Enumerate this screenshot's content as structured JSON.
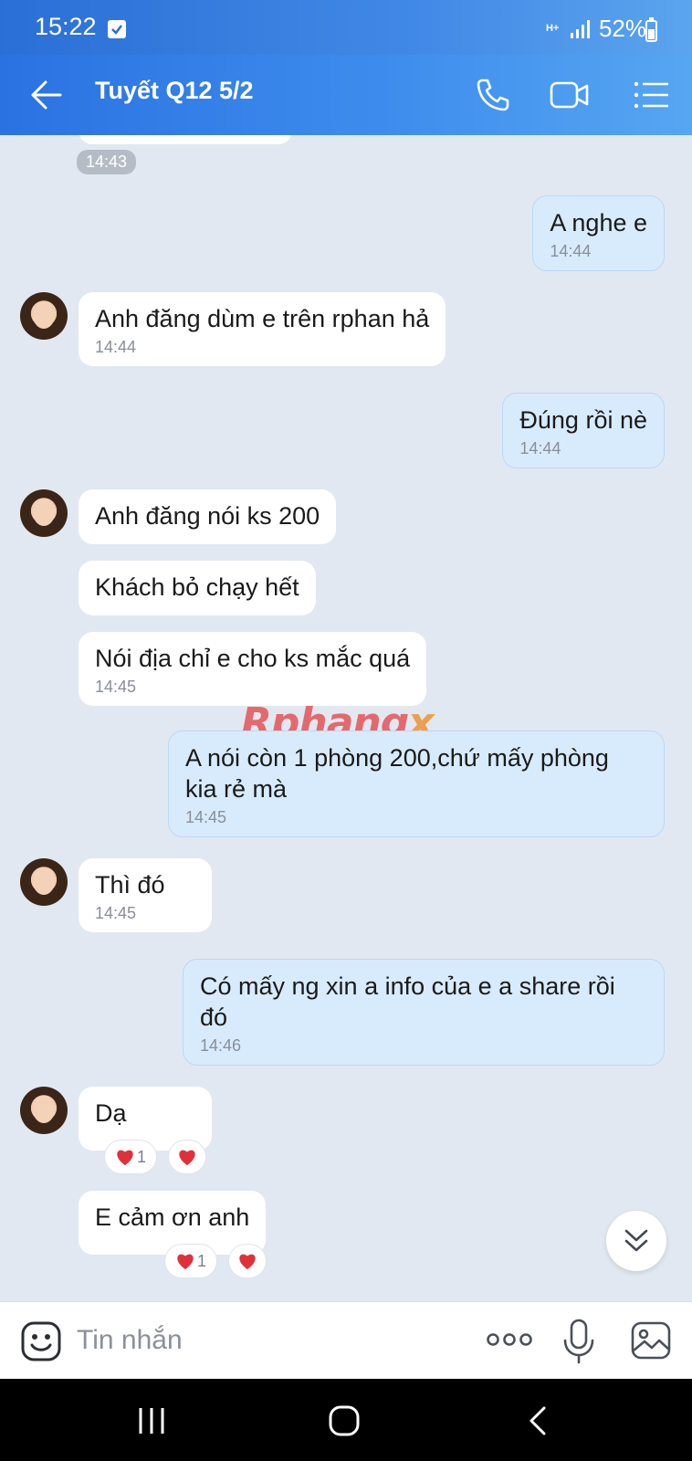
{
  "status_bar": {
    "time": "15:22",
    "network": "H+",
    "battery": "52%"
  },
  "header": {
    "title": "Tuyết Q12 5/2"
  },
  "chat": {
    "top_timestamp": "14:43",
    "messages": [
      {
        "side": "out",
        "text": "A nghe e",
        "time": "14:44"
      },
      {
        "side": "in",
        "text": "Anh đăng dùm e trên rphan hả",
        "time": "14:44"
      },
      {
        "side": "out",
        "text": "Đúng rồi nè",
        "time": "14:44"
      },
      {
        "side": "in",
        "text": "Anh đăng nói ks 200",
        "time": ""
      },
      {
        "side": "in",
        "text": "Khách bỏ chạy hết",
        "time": ""
      },
      {
        "side": "in",
        "text": "Nói địa chỉ e cho ks mắc quá",
        "time": "14:45"
      },
      {
        "side": "out",
        "text": "A nói còn 1 phòng 200,chứ mấy phòng\nkia rẻ mà",
        "time": "14:45"
      },
      {
        "side": "in",
        "text": "Thì đó",
        "time": "14:45"
      },
      {
        "side": "out",
        "text": "Có mấy ng xin a info của e a share rồi\nđó",
        "time": "14:46"
      },
      {
        "side": "in",
        "text": "Dạ",
        "time": "",
        "reaction_count": "1"
      },
      {
        "side": "in",
        "text": "E cảm ơn anh",
        "time": "",
        "reaction_count": "1"
      }
    ]
  },
  "watermark": {
    "main": "Rphang",
    "accent": "x"
  },
  "input_bar": {
    "placeholder": "Tin nhắn"
  },
  "icons": {
    "back": "arrow-left-icon",
    "call": "phone-icon",
    "video": "video-camera-icon",
    "menu": "list-menu-icon",
    "sticker": "smiley-icon",
    "more": "more-dots-icon",
    "mic": "microphone-icon",
    "image": "image-icon",
    "scroll": "double-chevron-down-icon"
  },
  "colors": {
    "header": "#3d8ced",
    "outgoing_bubble": "#d8ebfd",
    "incoming_bubble": "#ffffff",
    "chat_background": "#e2e8f1",
    "heart": "#e0303a"
  }
}
